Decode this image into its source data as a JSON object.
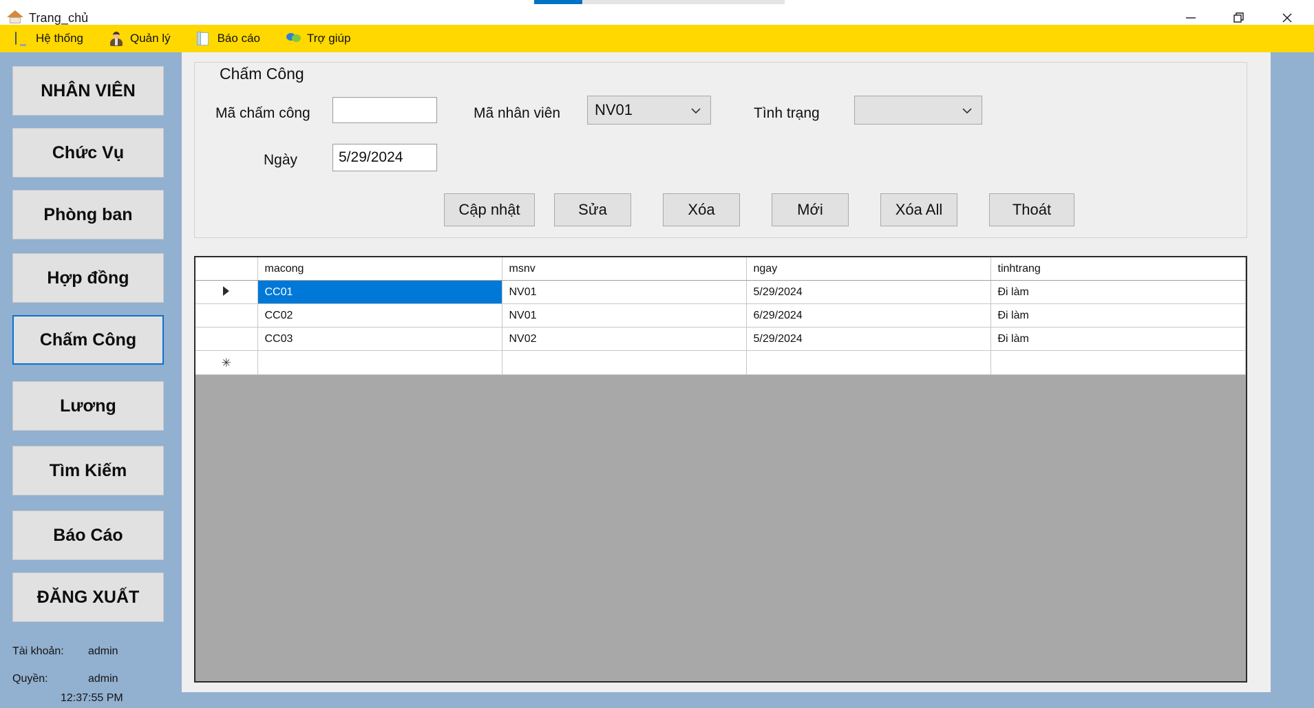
{
  "window": {
    "title": "Trang_chủ",
    "icon": "home-icon",
    "controls": {
      "minimize": "minimize-icon",
      "restore": "restore-icon",
      "close": "close-icon"
    }
  },
  "menubar": {
    "items": [
      {
        "label": "Hệ thống",
        "icon": "monitor-icon"
      },
      {
        "label": "Quản lý",
        "icon": "person-icon"
      },
      {
        "label": "Báo cáo",
        "icon": "document-icon"
      },
      {
        "label": "Trợ giúp",
        "icon": "chat-bubble-icon"
      }
    ]
  },
  "sidebar": {
    "items": [
      {
        "label": "NHÂN VIÊN",
        "focused": false
      },
      {
        "label": "Chức Vụ",
        "focused": false
      },
      {
        "label": "Phòng ban",
        "focused": false
      },
      {
        "label": "Hợp đồng",
        "focused": false
      },
      {
        "label": "Chấm Công",
        "focused": true
      },
      {
        "label": "Lương",
        "focused": false
      },
      {
        "label": "Tìm Kiếm",
        "focused": false
      },
      {
        "label": "Báo Cáo",
        "focused": false
      },
      {
        "label": "ĐĂNG XUẤT",
        "focused": false
      }
    ],
    "account_label": "Tài khoản:",
    "account_value": "admin",
    "role_label": "Quyền:",
    "role_value": "admin",
    "time": "12:37:55 PM"
  },
  "form": {
    "legend": "Chấm Công",
    "fields": {
      "ma_cham_cong_label": "Mã chấm công",
      "ma_cham_cong_value": "",
      "ma_cham_cong_placeholder": "",
      "ma_nhan_vien_label": "Mã nhân viên",
      "ma_nhan_vien_value": "NV01",
      "tinh_trang_label": "Tình trạng",
      "tinh_trang_value": "",
      "ngay_label": "Ngày",
      "ngay_value": "5/29/2024"
    },
    "buttons": [
      "Cập nhật",
      "Sửa",
      "Xóa",
      "Mới",
      "Xóa All",
      "Thoát"
    ]
  },
  "grid": {
    "columns": [
      "",
      "macong",
      "msnv",
      "ngay",
      "tinhtrang"
    ],
    "rows": [
      {
        "marker": "arrow",
        "selected": true,
        "macong": "CC01",
        "msnv": "NV01",
        "ngay": "5/29/2024",
        "tinhtrang": "Đi làm"
      },
      {
        "marker": "",
        "selected": false,
        "macong": "CC02",
        "msnv": "NV01",
        "ngay": "6/29/2024",
        "tinhtrang": "Đi làm"
      },
      {
        "marker": "",
        "selected": false,
        "macong": "CC03",
        "msnv": "NV02",
        "ngay": "5/29/2024",
        "tinhtrang": "Đi làm"
      },
      {
        "marker": "star",
        "selected": false,
        "macong": "",
        "msnv": "",
        "ngay": "",
        "tinhtrang": ""
      }
    ]
  },
  "colors": {
    "menubar": "#ffd800",
    "sidebar": "#92b0d0",
    "panel": "#efefef",
    "selection": "#0078d7",
    "focus_border": "#0a72d0",
    "grid_empty": "#a8a8a8"
  }
}
